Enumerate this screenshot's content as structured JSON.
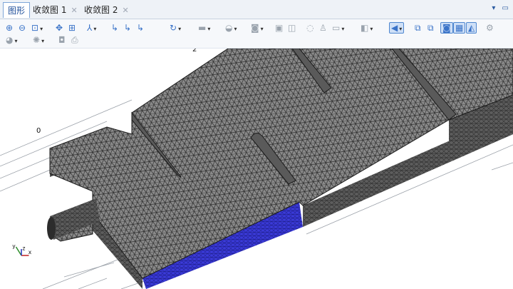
{
  "tabs": [
    {
      "label": "图形",
      "active": true
    },
    {
      "label": "收敛图 1",
      "active": false
    },
    {
      "label": "收敛图 2",
      "active": false
    }
  ],
  "toolbar": {
    "row1": [
      {
        "icon": "zoom-in-icon"
      },
      {
        "icon": "zoom-out-icon"
      },
      {
        "icon": "zoom-box-icon"
      },
      {
        "icon": "pan-icon"
      },
      {
        "icon": "zoom-extents-icon"
      },
      {
        "icon": "axis-xyz-icon"
      },
      {
        "icon": "view-xy-icon"
      },
      {
        "icon": "view-yz-icon"
      },
      {
        "icon": "view-zx-icon"
      },
      {
        "icon": "rotate-icon"
      },
      {
        "icon": "select-domain-icon"
      },
      {
        "icon": "select-boundary-icon"
      },
      {
        "icon": "select-edge-icon"
      },
      {
        "icon": "clear-selection-icon"
      },
      {
        "icon": "hide-icon"
      },
      {
        "icon": "show-icon"
      },
      {
        "icon": "transparency-icon"
      },
      {
        "icon": "copy-icon"
      },
      {
        "icon": "scene-light-icon"
      },
      {
        "icon": "wireframe-icon"
      },
      {
        "icon": "render-icon"
      },
      {
        "icon": "grid-icon"
      },
      {
        "icon": "plot-icon"
      },
      {
        "icon": "settings-icon"
      }
    ],
    "row2": [
      {
        "icon": "light-icon"
      },
      {
        "icon": "camera-icon"
      },
      {
        "icon": "snapshot-icon"
      },
      {
        "icon": "print-icon"
      }
    ]
  },
  "axes_labels": {
    "z": "z",
    "x": "x",
    "y": "y"
  },
  "tick_labels": {
    "top": "2",
    "left": "0"
  },
  "colors": {
    "mesh_face": "#8a8a8a",
    "mesh_line": "#2c2c2c",
    "selection": "#3a3ad8",
    "tab_active": "#1f4f9a"
  }
}
